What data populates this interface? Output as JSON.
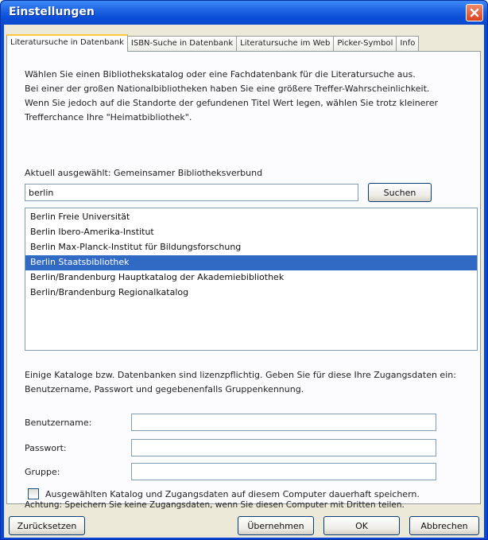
{
  "window": {
    "title": "Einstellungen"
  },
  "tabs": [
    {
      "label": "Literatursuche in Datenbank",
      "active": true
    },
    {
      "label": "ISBN-Suche in Datenbank",
      "active": false
    },
    {
      "label": "Literatursuche im Web",
      "active": false
    },
    {
      "label": "Picker-Symbol",
      "active": false
    },
    {
      "label": "Info",
      "active": false
    }
  ],
  "intro": {
    "line1": "Wählen Sie einen Bibliothekskatalog oder eine Fachdatenbank für die Literatursuche aus.",
    "line2": "Bei einer der großen Nationalbibliotheken haben Sie eine größere Treffer-Wahrscheinlichkeit.",
    "line3": "Wenn Sie jedoch auf die Standorte der gefundenen Titel Wert legen, wählen Sie trotz kleinerer",
    "line4": "Trefferchance Ihre \"Heimatbibliothek\"."
  },
  "current": {
    "label": "Aktuell ausgewählt: Gemeinsamer Bibliotheksverbund"
  },
  "search": {
    "value": "berlin",
    "button_label": "Suchen"
  },
  "results": [
    {
      "label": "Berlin Freie Universität",
      "selected": false
    },
    {
      "label": "Berlin Ibero-Amerika-Institut",
      "selected": false
    },
    {
      "label": "Berlin Max-Planck-Institut für Bildungsforschung",
      "selected": false
    },
    {
      "label": "Berlin Staatsbibliothek",
      "selected": true
    },
    {
      "label": "Berlin/Brandenburg Hauptkatalog der Akademiebibliothek",
      "selected": false
    },
    {
      "label": "Berlin/Brandenburg Regionalkatalog",
      "selected": false
    }
  ],
  "license": {
    "line1": "Einige Kataloge bzw. Datenbanken sind lizenzpflichtig. Geben Sie für diese Ihre Zugangsdaten ein:",
    "line2": "Benutzername, Passwort und gegebenenfalls Gruppenkennung."
  },
  "fields": {
    "username_label": "Benutzername:",
    "username_value": "",
    "password_label": "Passwort:",
    "password_value": "",
    "group_label": "Gruppe:",
    "group_value": ""
  },
  "save": {
    "checkbox_label": "Ausgewählten Katalog und Zugangsdaten auf diesem Computer dauerhaft speichern.",
    "checked": false,
    "warning": "Achtung: Speichern Sie keine Zugangsdaten, wenn Sie diesen Computer mit Dritten teilen."
  },
  "footer": {
    "reset_label": "Zurücksetzen",
    "apply_label": "Übernehmen",
    "ok_label": "OK",
    "cancel_label": "Abbrechen"
  },
  "colors": {
    "title_bar": "#0b4fd8",
    "selection": "#316ac5",
    "tab_highlight": "#ffc83c",
    "close_button": "#d9421d"
  }
}
